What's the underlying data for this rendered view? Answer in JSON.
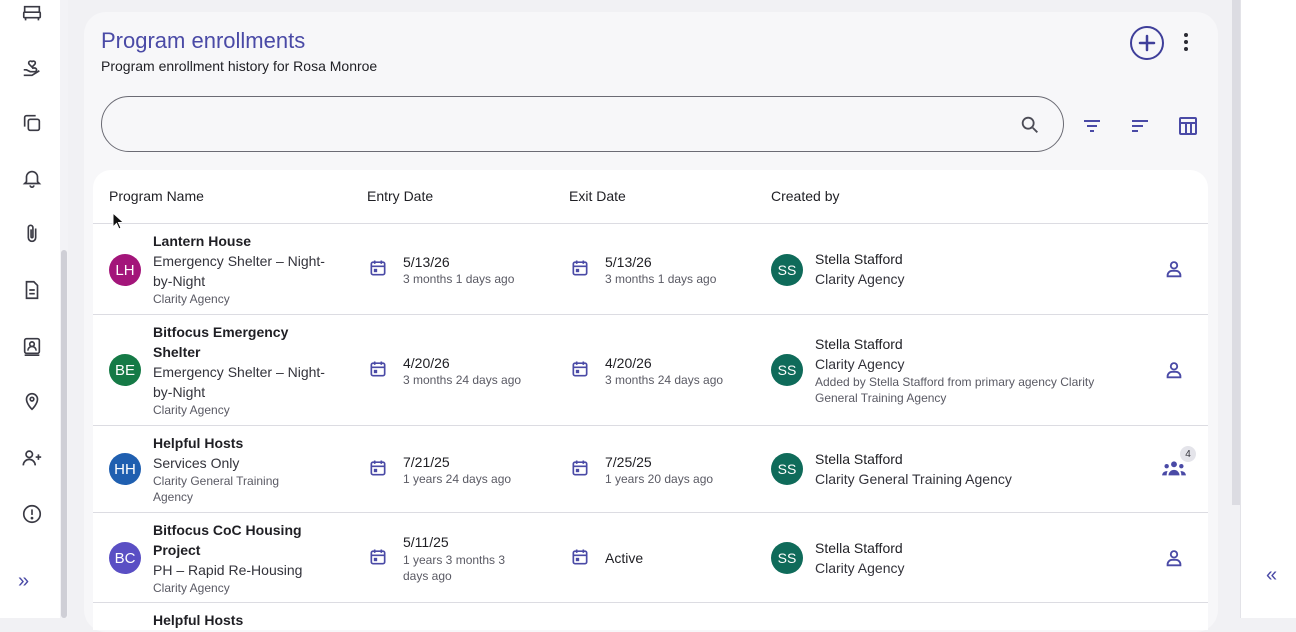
{
  "page": {
    "title": "Program enrollments",
    "subtitle": "Program enrollment history for Rosa Monroe"
  },
  "search": {
    "placeholder": "",
    "value": ""
  },
  "toolbar": {
    "add_icon": "add-circle-icon",
    "more_icon": "more-vertical-icon",
    "filter_icon": "filter-icon",
    "sort_icon": "sort-icon",
    "columns_icon": "table-columns-icon"
  },
  "sidebar": {
    "icons": [
      "bed-icon",
      "hand-heart-icon",
      "copy-icon",
      "bell-icon",
      "paperclip-icon",
      "document-icon",
      "contact-card-icon",
      "location-pin-icon",
      "add-person-icon",
      "alert-circle-icon"
    ],
    "expand_label": "»"
  },
  "right_panel": {
    "collapse_label": "«"
  },
  "table": {
    "headers": [
      "Program Name",
      "Entry Date",
      "Exit Date",
      "Created by"
    ],
    "rows": [
      {
        "initials": "LH",
        "avatar_color": "#a3157a",
        "name": "Lantern House",
        "type": "Emergency Shelter – Night-by-Night",
        "agency": "Clarity Agency",
        "entry_date": "5/13/26",
        "entry_ago": "3 months 1 days ago",
        "exit_date": "5/13/26",
        "exit_ago": "3 months 1 days ago",
        "creator_initials": "SS",
        "creator": "Stella Stafford",
        "creator_agency": "Clarity Agency",
        "note": "",
        "members_icon": "person-icon",
        "member_count": ""
      },
      {
        "initials": "BE",
        "avatar_color": "#157a46",
        "name": "Bitfocus Emergency Shelter",
        "type": "Emergency Shelter – Night-by-Night",
        "agency": "Clarity Agency",
        "entry_date": "4/20/26",
        "entry_ago": "3 months 24 days ago",
        "exit_date": "4/20/26",
        "exit_ago": "3 months 24 days ago",
        "creator_initials": "SS",
        "creator": "Stella Stafford",
        "creator_agency": "Clarity Agency",
        "note": "Added by Stella Stafford from primary agency Clarity General Training Agency",
        "members_icon": "person-icon",
        "member_count": ""
      },
      {
        "initials": "HH",
        "avatar_color": "#1f5fb0",
        "name": "Helpful Hosts",
        "type": "Services Only",
        "agency": "Clarity General Training Agency",
        "entry_date": "7/21/25",
        "entry_ago": "1 years 24 days ago",
        "exit_date": "7/25/25",
        "exit_ago": "1 years 20 days ago",
        "creator_initials": "SS",
        "creator": "Stella Stafford",
        "creator_agency": "Clarity General Training Agency",
        "note": "",
        "members_icon": "group-icon",
        "member_count": "4"
      },
      {
        "initials": "BC",
        "avatar_color": "#5a4fc4",
        "name": "Bitfocus CoC Housing Project",
        "type": "PH – Rapid Re-Housing",
        "agency": "Clarity Agency",
        "entry_date": "5/11/25",
        "entry_ago": "1 years 3 months 3 days ago",
        "exit_date": "Active",
        "exit_ago": "",
        "creator_initials": "SS",
        "creator": "Stella Stafford",
        "creator_agency": "Clarity Agency",
        "note": "",
        "members_icon": "person-icon",
        "member_count": ""
      },
      {
        "initials": "",
        "avatar_color": "#1f5fb0",
        "name": "Helpful Hosts",
        "type": "",
        "agency": "",
        "entry_date": "",
        "entry_ago": "",
        "exit_date": "",
        "exit_ago": "",
        "creator_initials": "",
        "creator": "",
        "creator_agency": "",
        "note": "",
        "members_icon": "",
        "member_count": ""
      }
    ]
  }
}
